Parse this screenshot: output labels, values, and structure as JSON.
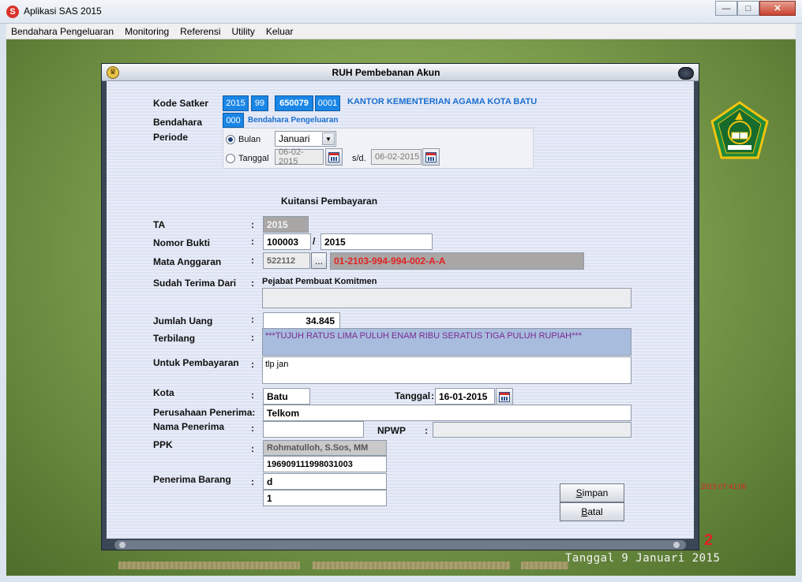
{
  "window": {
    "title": "Aplikasi SAS 2015",
    "app_icon": "S"
  },
  "menu": [
    {
      "label": "Bendahara Pengeluaran"
    },
    {
      "label": "Monitoring"
    },
    {
      "label": "Referensi"
    },
    {
      "label": "Utility"
    },
    {
      "label": "Keluar"
    }
  ],
  "dialog": {
    "title": "RUH Pembebanan Akun",
    "kode_satker": {
      "label": "Kode Satker",
      "seg1": "2015",
      "seg2": "99",
      "seg3": "650079",
      "seg4": "0001",
      "name": "KANTOR KEMENTERIAN AGAMA KOTA BATU"
    },
    "bendahara": {
      "label": "Bendahara",
      "code": "000",
      "name": "Bendahara Pengeluaran"
    },
    "periode": {
      "label": "Periode",
      "bulan_label": "Bulan",
      "bulan_value": "Januari",
      "tanggal_label": "Tanggal",
      "date_from": "06-02-2015",
      "sd_label": "s/d.",
      "date_to": "06-02-2015"
    },
    "section_title": "Kuitansi Pembayaran",
    "ta": {
      "label": "TA",
      "value": "2015"
    },
    "nomor_bukti": {
      "label": "Nomor Bukti",
      "value1": "100003",
      "sep": "/",
      "value2": "2015"
    },
    "mata_anggaran": {
      "label": "Mata Anggaran",
      "code": "522112",
      "browse": "...",
      "account": "01-2103-994-994-002-A-A"
    },
    "sudah_terima": {
      "label": "Sudah Terima Dari",
      "value": "Pejabat Pembuat Komitmen",
      "extra": ""
    },
    "jumlah_uang": {
      "label": "Jumlah Uang",
      "value": "34.845"
    },
    "terbilang": {
      "label": "Terbilang",
      "value": "***TUJUH RATUS LIMA PULUH ENAM RIBU SERATUS TIGA PULUH RUPIAH***"
    },
    "untuk_pembayaran": {
      "label": "Untuk Pembayaran",
      "value": "tlp jan"
    },
    "kota": {
      "label": "Kota",
      "value": "Batu"
    },
    "tanggal": {
      "label": "Tanggal",
      "value": "16-01-2015"
    },
    "perusahaan": {
      "label": "Perusahaan Penerima:",
      "value": "Telkom"
    },
    "nama_penerima": {
      "label": "Nama  Penerima",
      "value": ""
    },
    "npwp": {
      "label": "NPWP",
      "value": ""
    },
    "ppk": {
      "label": "PPK",
      "name": "Rohmatulloh, S.Sos, MM",
      "nip": "196909111998031003"
    },
    "penerima_barang": {
      "label": "Penerima Barang",
      "value1": "d",
      "value2": "1"
    },
    "buttons": {
      "simpan_first": "S",
      "simpan_rest": "impan",
      "batal_first": "B",
      "batal_rest": "atal"
    },
    "colon": ":"
  },
  "status": {
    "time": "2015 07:41:06",
    "number": "2",
    "tanggal": "Tanggal 9 Januari 2015"
  },
  "colors": {
    "accent_blue": "#1a86e6",
    "account_red": "#e02222",
    "terbilang_purple": "#7a2b8f"
  }
}
